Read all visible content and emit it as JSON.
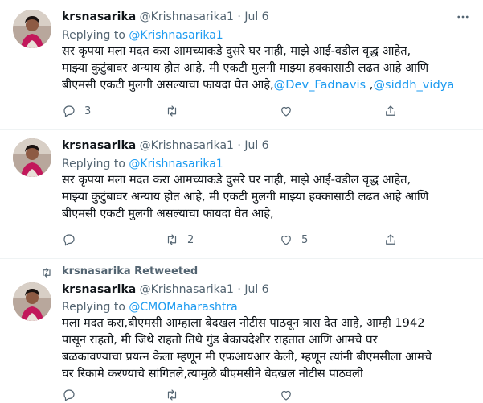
{
  "tweets": [
    {
      "author_name": "krsnasarika",
      "author_handle": "@Krishnasarika1",
      "date_sep": "·",
      "date": "Jul 6",
      "replying_label": "Replying to",
      "replying_to": "@Krishnasarika1",
      "lines": [
        "सर कृपया मला मदत करा आमच्याकडे दुसरे घर नाही, माझे आई-वडील वृद्ध आहेत,",
        "माझ्या कुटुंबावर अन्याय होत आहे, मी एकटी मुलगी माझ्या हक्कासाठी लढत आहे आणि"
      ],
      "last_line_text": "बीएमसी एकटी मुलगी असल्याचा फायदा घेत आहे,",
      "mention_1": "@Dev_Fadnavis",
      "mention_sep": " ,",
      "mention_2": "@siddh_vidya",
      "reply_count": "3",
      "retweet_count": "",
      "like_count": ""
    },
    {
      "author_name": "krsnasarika",
      "author_handle": "@Krishnasarika1",
      "date_sep": "·",
      "date": "Jul 6",
      "replying_label": "Replying to",
      "replying_to": "@Krishnasarika1",
      "lines": [
        "सर कृपया मला मदत करा आमच्याकडे दुसरे घर नाही, माझे आई-वडील वृद्ध आहेत,",
        "माझ्या कुटुंबावर अन्याय होत आहे, मी एकटी मुलगी माझ्या हक्कासाठी लढत आहे आणि",
        "बीएमसी एकटी मुलगी असल्याचा फायदा घेत आहे,"
      ],
      "reply_count": "",
      "retweet_count": "2",
      "like_count": "5"
    },
    {
      "retweeted_label": "krsnasarika Retweeted",
      "author_name": "krsnasarika",
      "author_handle": "@Krishnasarika1",
      "date_sep": "·",
      "date": "Jul 6",
      "replying_label": "Replying to",
      "replying_to": "@CMOMaharashtra",
      "lines": [
        "मला मदत करा,बीएमसी आम्हाला बेदखल नोटीस पाठवून त्रास देत आहे, आम्ही 1942",
        "पासून राहतो, मी जिथे राहतो तिथे गुंड बेकायदेशीर राहतात आणि आमचे घर",
        "बळकावण्याचा प्रयत्न केला म्हणून मी एफआयआर केली, म्हणून त्यांनी बीएमसीला आमचे",
        "घर रिकामे करण्याचे सांगितले,त्यामुळे बीएमसीने बेदखल नोटीस पाठवली"
      ]
    }
  ],
  "colors": {
    "link": "#1d9bf0",
    "muted": "#536471",
    "text": "#0f1419",
    "separator": "#eff3f4"
  },
  "icons": [
    "avatar",
    "more-icon",
    "reply-icon",
    "retweet-icon",
    "like-icon",
    "share-icon"
  ]
}
